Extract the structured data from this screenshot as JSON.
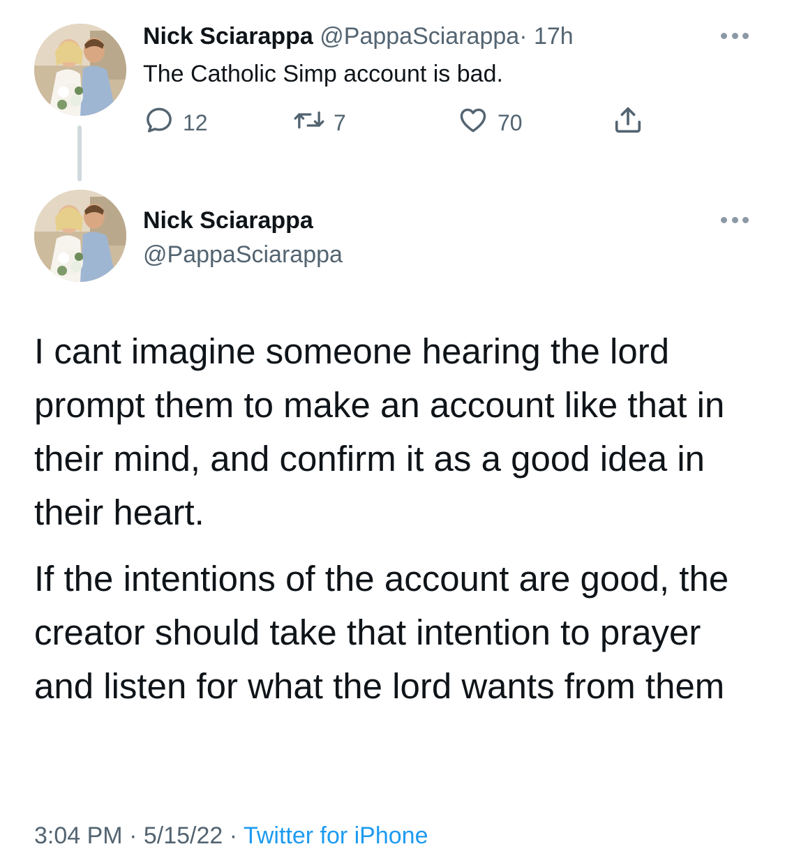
{
  "parent_tweet": {
    "display_name": "Nick Sciarappa",
    "handle": "@PappaSciarappa",
    "separator": "·",
    "time_ago": "17h",
    "text": "The Catholic Simp account is bad.",
    "reply_count": "12",
    "retweet_count": "7",
    "like_count": "70",
    "icons": [
      "reply-icon",
      "retweet-icon",
      "like-icon",
      "share-icon",
      "more-icon"
    ]
  },
  "main_tweet": {
    "display_name": "Nick Sciarappa",
    "handle": "@PappaSciarappa",
    "paragraphs": [
      "I cant imagine someone hearing the lord prompt them to make an account like that in their mind, and confirm it as a good idea in their heart.",
      "If the intentions of the account are good, the creator should take that intention to prayer and listen for what the lord wants from them"
    ],
    "time": "3:04 PM",
    "separator": "·",
    "date": "5/15/22",
    "source": "Twitter for iPhone"
  },
  "colors": {
    "text": "#0f1419",
    "muted": "#536471",
    "link": "#1d9bf0",
    "thread_line": "#cfd9de"
  }
}
